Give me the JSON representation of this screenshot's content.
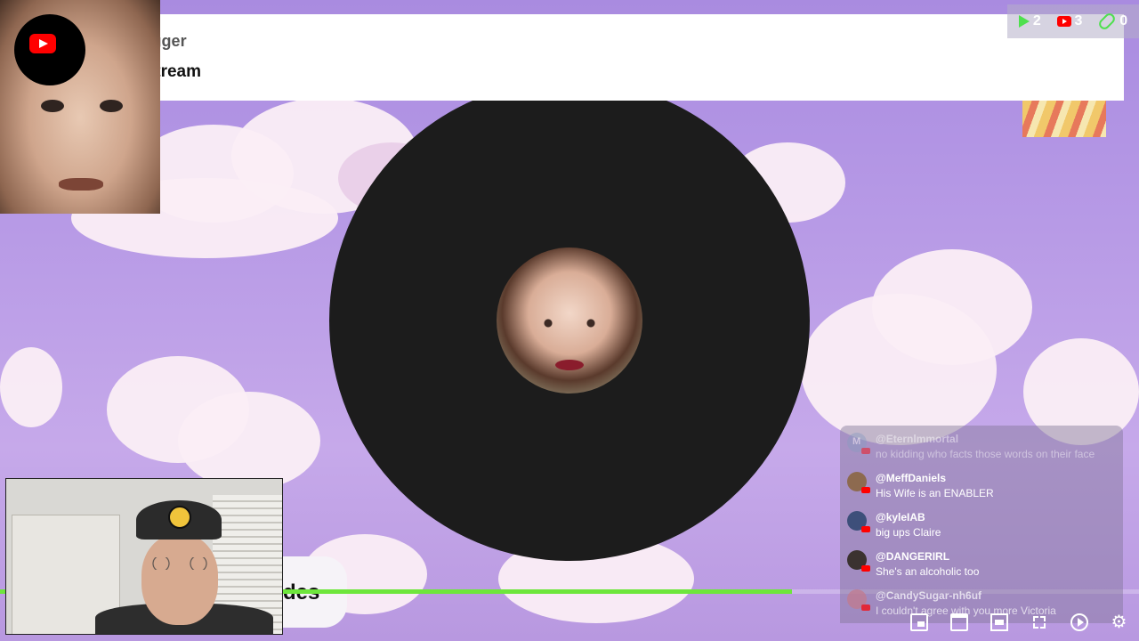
{
  "alert": {
    "username": "@DrJogger",
    "message": "good stream"
  },
  "counters": [
    {
      "icon": "play-icon",
      "value": "2"
    },
    {
      "icon": "youtube-icon",
      "value": "3"
    },
    {
      "icon": "link-icon",
      "value": "0"
    }
  ],
  "caption": {
    "text": "des"
  },
  "progress": {
    "fraction": 0.695
  },
  "chat": {
    "messages": [
      {
        "user": "@Eternlmmortal",
        "text": "no kidding who facts those words on their face",
        "initial": "M"
      },
      {
        "user": "@MeffDaniels",
        "text": "His Wife is an ENABLER",
        "initial": ""
      },
      {
        "user": "@kyleIAB",
        "text": "big ups Claire",
        "initial": ""
      },
      {
        "user": "@DANGERIRL",
        "text": "She's an alcoholic too",
        "initial": ""
      },
      {
        "user": "@CandySugar-nh6uf",
        "text": "I couldn't agree with you more Victoria",
        "initial": ""
      }
    ]
  },
  "controls": [
    {
      "name": "miniplayer-icon"
    },
    {
      "name": "clip-icon"
    },
    {
      "name": "theater-mode-icon"
    },
    {
      "name": "fullscreen-icon"
    },
    {
      "name": "autoplay-icon"
    },
    {
      "name": "settings-gear-icon",
      "glyph": "⚙"
    }
  ],
  "colors": {
    "accent_green": "#6ee63c",
    "youtube_red": "#ff0000",
    "vinyl": "#1c1c1c",
    "background": "#b79ae6"
  }
}
